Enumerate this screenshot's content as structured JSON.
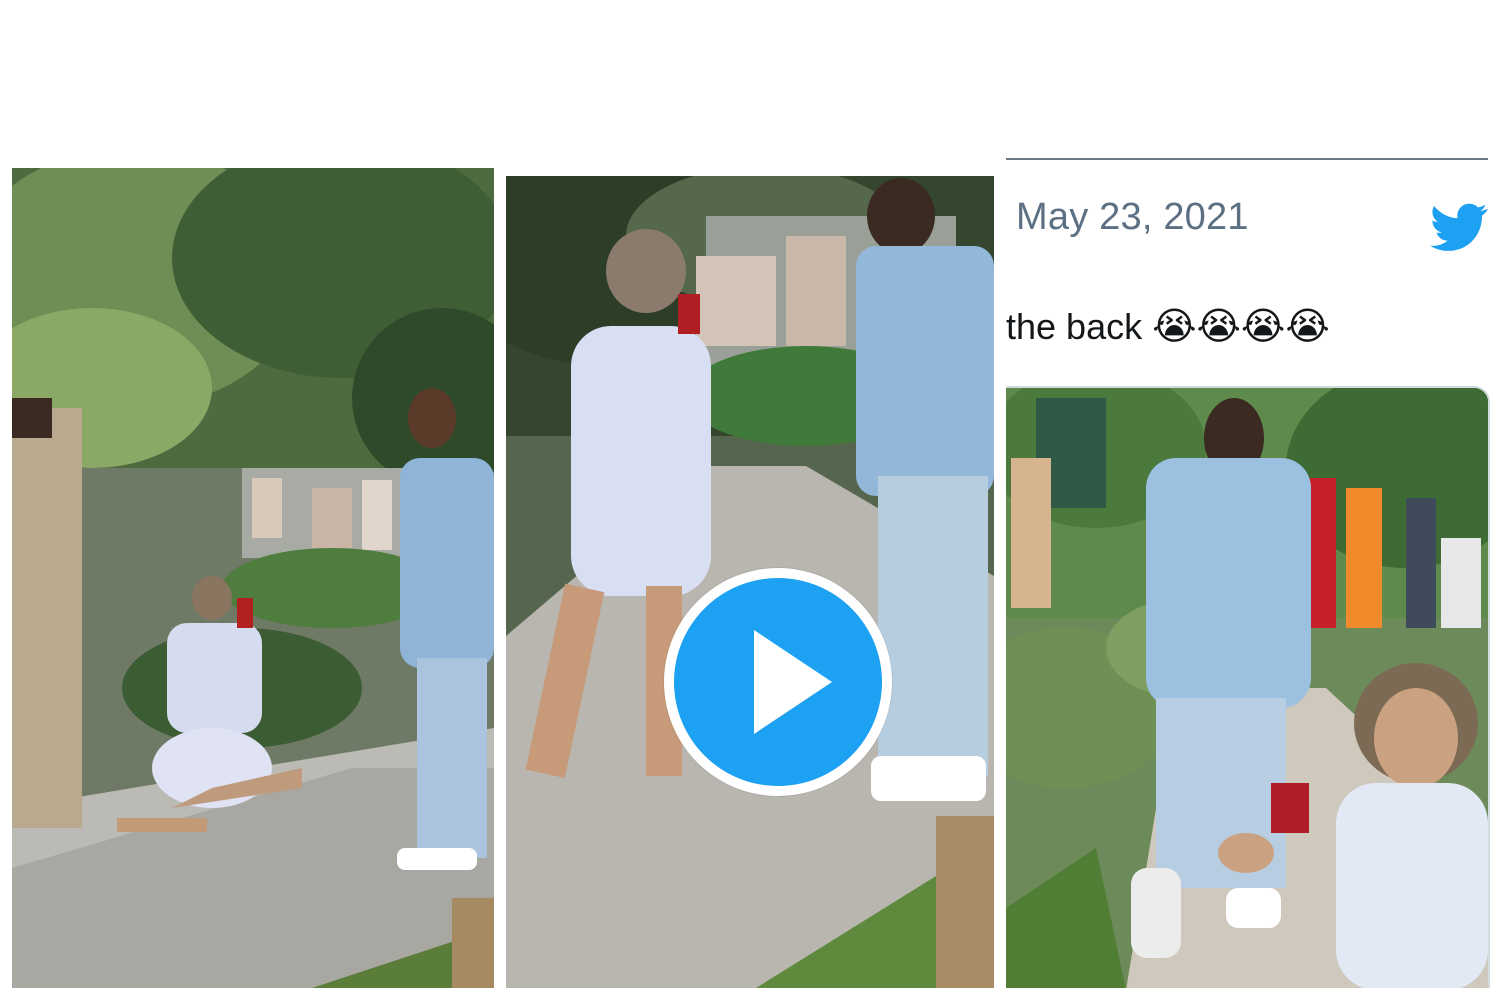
{
  "collage": {
    "panel1": {
      "alt": "Woman kneeling with ring box proposing to man in light denim outfit on garden path"
    },
    "panel2": {
      "alt": "Video frame of woman holding ring box facing man on garden path",
      "play_icon": "play-icon"
    },
    "panel3": {
      "tweet": {
        "date": "May 23, 2021",
        "text": "the back",
        "emoji": "😭😭😭😭",
        "brand_icon": "twitter-bird-icon",
        "brand_color": "#1da1f2"
      },
      "media_alt": "Woman kneeling and laughing holding red ring box while man walks away on garden path"
    }
  }
}
